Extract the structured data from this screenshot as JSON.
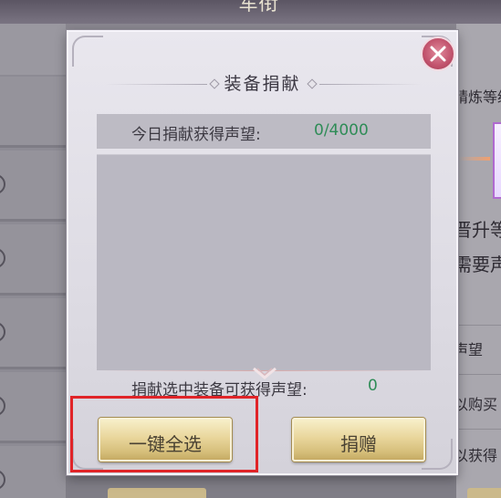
{
  "background": {
    "top_title": "军衔",
    "right_texts": [
      "精炼等级",
      "晋升等",
      "需要声",
      "声望",
      "以购买",
      "以获得"
    ]
  },
  "dialog": {
    "title": "装备捐献",
    "today_label": "今日捐献获得声望:",
    "today_value": "0/4000",
    "selected_label": "捐献选中装备可获得声望:",
    "selected_value": "0",
    "buttons": {
      "select_all": "一键全选",
      "donate": "捐赠"
    }
  },
  "colors": {
    "value_green": "#2f8c57",
    "highlight_red": "#e02428",
    "button_gold": "#e9d69c"
  },
  "icons": {
    "close": "close-icon",
    "scroll": "chevron-down-icon"
  }
}
